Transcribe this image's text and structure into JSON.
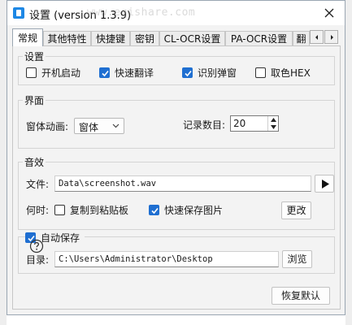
{
  "window": {
    "title": "设置 (version 1.3.9)",
    "watermark": "www.eqishare.com"
  },
  "tabs": [
    {
      "label": "常规",
      "active": true
    },
    {
      "label": "其他特性",
      "active": false
    },
    {
      "label": "快捷键",
      "active": false
    },
    {
      "label": "密钥",
      "active": false
    },
    {
      "label": "CL-OCR设置",
      "active": false
    },
    {
      "label": "PA-OCR设置",
      "active": false
    },
    {
      "label": "翻",
      "active": false
    }
  ],
  "settings_group": {
    "title": "设置",
    "checkboxes": [
      {
        "label": "开机启动",
        "checked": false
      },
      {
        "label": "快速翻译",
        "checked": true
      },
      {
        "label": "识别弹窗",
        "checked": true
      },
      {
        "label": "取色HEX",
        "checked": false
      }
    ]
  },
  "ui_group": {
    "title": "界面",
    "animation_label": "窗体动画:",
    "animation_value": "窗体",
    "record_label": "记录数目:",
    "record_value": "20"
  },
  "sound_group": {
    "title": "音效",
    "file_label": "文件:",
    "file_value": "Data\\screenshot.wav",
    "when_label": "何时:",
    "copy_check": {
      "label": "复制到粘贴板",
      "checked": false
    },
    "save_check": {
      "label": "快速保存图片",
      "checked": true
    },
    "change_button": "更改"
  },
  "autosave_group": {
    "title": "自动保存",
    "checked": true,
    "dir_label": "目录:",
    "dir_value": "C:\\Users\\Administrator\\Desktop",
    "browse_button": "浏览"
  },
  "footer": {
    "reset_button": "恢复默认"
  },
  "colors": {
    "accent": "#1f6fd1",
    "app_icon": "#1e88e5"
  },
  "icons": {
    "app": "app-icon",
    "close": "close-icon",
    "play": "play-icon",
    "help": "help-icon",
    "tab_prev": "chevron-left-icon",
    "tab_next": "chevron-right-icon"
  }
}
